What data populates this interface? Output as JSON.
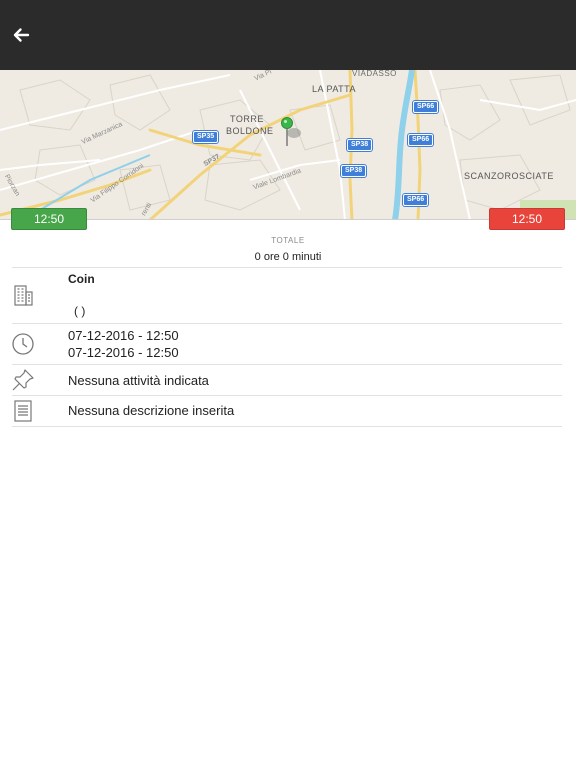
{
  "header": {
    "back_icon": "arrow-left-icon"
  },
  "map": {
    "places": {
      "torre": "TORRE",
      "boldone": "BOLDONE",
      "la_patta": "LA PATTA",
      "viadasso": "VIADASSO",
      "scanzorosciate": "SCANZOROSCIATE"
    },
    "streets": {
      "via_marzanica": "Via Marzanica",
      "via_filippo_corridoni": "Via Filippo Corridoni",
      "viale_lombardia": "Viale Lombardia",
      "via_pl": "Via Pl",
      "renti": "renti",
      "piorzani": "Piorzan"
    },
    "shields": {
      "sp35": "SP35",
      "sp37": "SP37",
      "sp38_a": "SP38",
      "sp38_b": "SP38",
      "sp66_a": "SP66",
      "sp66_b": "SP66",
      "sp66_c": "SP66"
    },
    "pin_color": "#3cb64a",
    "water_color": "#8fd0ea",
    "road_color": "#f2d37a"
  },
  "times": {
    "start": "12:50",
    "end": "12:50",
    "start_color": "#47a64a",
    "end_color": "#e8443b"
  },
  "total": {
    "caption": "TOTALE",
    "value": "0 ore 0 minuti"
  },
  "details": {
    "company_name": "Coin",
    "company_address": "( )",
    "start_datetime": "07-12-2016 - 12:50",
    "end_datetime": "07-12-2016 - 12:50",
    "activity": "Nessuna attività indicata",
    "description": "Nessuna descrizione inserita"
  }
}
